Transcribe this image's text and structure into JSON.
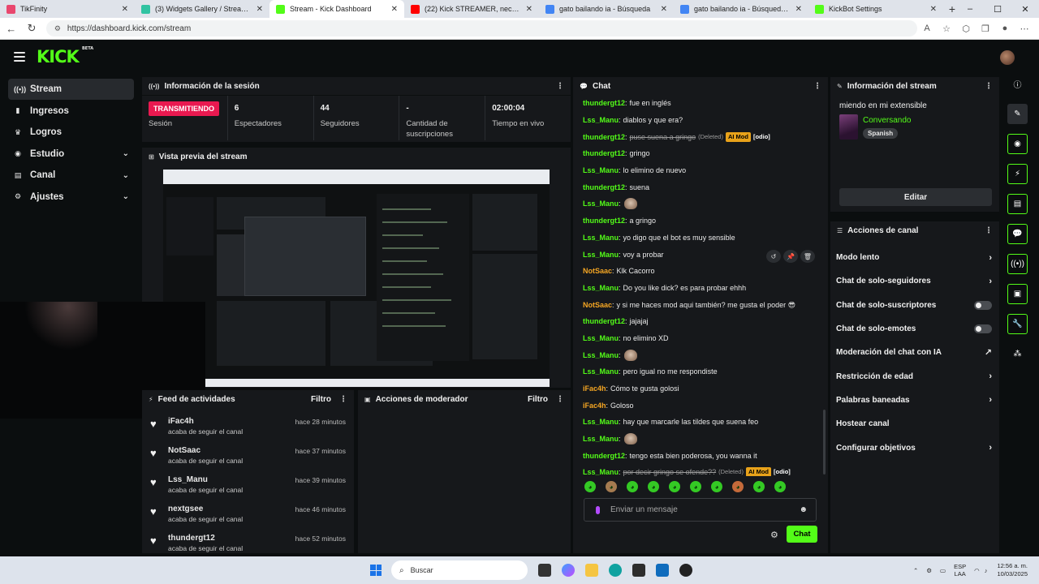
{
  "browser": {
    "tabs": [
      {
        "title": "TikFinity",
        "color": "#e9476e"
      },
      {
        "title": "(3) Widgets Gallery / Streamlabs",
        "color": "#31c3a2"
      },
      {
        "title": "Stream - Kick Dashboard",
        "color": "#53fc18"
      },
      {
        "title": "(22) Kick STREAMER, necesitas Ki",
        "color": "#ff0000"
      },
      {
        "title": "gato bailando ia - Búsqueda",
        "color": "#4285f4"
      },
      {
        "title": "gato bailando ia - Búsqueda Imá",
        "color": "#4285f4"
      },
      {
        "title": "KickBot Settings",
        "color": "#53fc18"
      }
    ],
    "url": "https://dashboard.kick.com/stream"
  },
  "app": {
    "logo": "KICK",
    "logo_badge": "BETA",
    "accent": "#53fc18",
    "sidebar": [
      {
        "label": "Stream",
        "icon": "signal-icon",
        "active": true
      },
      {
        "label": "Ingresos",
        "icon": "chart-icon"
      },
      {
        "label": "Logros",
        "icon": "trophy-icon"
      },
      {
        "label": "Estudio",
        "icon": "studio-icon",
        "chevron": true
      },
      {
        "label": "Canal",
        "icon": "channel-icon",
        "chevron": true
      },
      {
        "label": "Ajustes",
        "icon": "gear-icon",
        "chevron": true
      }
    ]
  },
  "session": {
    "title": "Información de la sesión",
    "status": "TRANSMITIENDO",
    "status_label": "Sesión",
    "stats": [
      {
        "value": "6",
        "label": "Espectadores"
      },
      {
        "value": "44",
        "label": "Seguidores"
      },
      {
        "value": "-",
        "label": "Cantidad de suscripciones"
      },
      {
        "value": "02:00:04",
        "label": "Tiempo en vivo"
      }
    ]
  },
  "preview": {
    "title": "Vista previa del stream"
  },
  "feed": {
    "title": "Feed de actividades",
    "filter": "Filtro",
    "items": [
      {
        "name": "iFac4h",
        "action": "acaba de seguir el canal",
        "time": "hace 28 minutos"
      },
      {
        "name": "NotSaac",
        "action": "acaba de seguir el canal",
        "time": "hace 37 minutos"
      },
      {
        "name": "Lss_Manu",
        "action": "acaba de seguir el canal",
        "time": "hace 39 minutos"
      },
      {
        "name": "nextgsee",
        "action": "acaba de seguir el canal",
        "time": "hace 46 minutos"
      },
      {
        "name": "thundergt12",
        "action": "acaba de seguir el canal",
        "time": "hace 52 minutos"
      }
    ]
  },
  "modactions": {
    "title": "Acciones de moderador",
    "filter": "Filtro"
  },
  "chat": {
    "title": "Chat",
    "placeholder": "Enviar un mensaje",
    "send": "Chat",
    "messages": [
      {
        "user": "thundergt12",
        "color": "#53fc18",
        "text": "fue en inglés"
      },
      {
        "user": "Lss_Manu",
        "color": "#53fc18",
        "text": "diablos y que era?"
      },
      {
        "user": "thundergt12",
        "color": "#53fc18",
        "text": "puse suena a gringo",
        "deleted": true,
        "deleted_label": "(Deleted)",
        "badge": "AI Mod",
        "tag": "[odio]"
      },
      {
        "user": "thundergt12",
        "color": "#53fc18",
        "text": "gringo"
      },
      {
        "user": "Lss_Manu",
        "color": "#53fc18",
        "text": "lo elimino de nuevo"
      },
      {
        "user": "thundergt12",
        "color": "#53fc18",
        "text": "suena"
      },
      {
        "user": "Lss_Manu",
        "color": "#53fc18",
        "text": "",
        "emote": true
      },
      {
        "user": "thundergt12",
        "color": "#53fc18",
        "text": "a gringo"
      },
      {
        "user": "Lss_Manu",
        "color": "#53fc18",
        "text": "yo digo que el bot es muy sensible"
      },
      {
        "user": "Lss_Manu",
        "color": "#53fc18",
        "text": "voy a probar"
      },
      {
        "user": "NotSaac",
        "color": "#f5a623",
        "text": "Klk Cacorro"
      },
      {
        "user": "Lss_Manu",
        "color": "#53fc18",
        "text": "Do you like dick? es para probar ehhh"
      },
      {
        "user": "NotSaac",
        "color": "#f5a623",
        "text": "y si me haces mod aqui también? me gusta el poder 😎"
      },
      {
        "user": "thundergt12",
        "color": "#53fc18",
        "text": "jajajaj"
      },
      {
        "user": "Lss_Manu",
        "color": "#53fc18",
        "text": "no elimino XD"
      },
      {
        "user": "Lss_Manu",
        "color": "#53fc18",
        "text": "",
        "emote": true
      },
      {
        "user": "Lss_Manu",
        "color": "#53fc18",
        "text": "pero igual no me respondiste"
      },
      {
        "user": "iFac4h",
        "color": "#f5a623",
        "text": "Cómo te gusta golosi"
      },
      {
        "user": "iFac4h",
        "color": "#f5a623",
        "text": "Goloso"
      },
      {
        "user": "Lss_Manu",
        "color": "#53fc18",
        "text": "hay que marcarle las tildes que suena feo"
      },
      {
        "user": "Lss_Manu",
        "color": "#53fc18",
        "text": "",
        "emote": true
      },
      {
        "user": "thundergt12",
        "color": "#53fc18",
        "text": "tengo esta bien poderosa, you wanna it"
      },
      {
        "user": "Lss_Manu",
        "color": "#53fc18",
        "text": "por decir gringo se ofende??",
        "deleted": true,
        "deleted_label": "(Deleted)",
        "badge": "AI Mod",
        "tag": "[odio]"
      }
    ]
  },
  "streaminfo": {
    "title": "Información del stream",
    "stream_title": "miendo en mi extensible",
    "category": "Conversando",
    "language": "Spanish",
    "edit": "Editar"
  },
  "channel_actions": {
    "title": "Acciones de canal",
    "items": [
      {
        "label": "Modo lento",
        "kind": "arrow"
      },
      {
        "label": "Chat de solo-seguidores",
        "kind": "arrow"
      },
      {
        "label": "Chat de solo-suscriptores",
        "kind": "toggle",
        "on": false
      },
      {
        "label": "Chat de solo-emotes",
        "kind": "toggle",
        "on": false
      },
      {
        "label": "Moderación del chat con IA",
        "kind": "ext"
      },
      {
        "label": "Restricción de edad",
        "kind": "arrow"
      },
      {
        "label": "Palabras baneadas",
        "kind": "arrow"
      },
      {
        "label": "Hostear canal",
        "kind": "none"
      },
      {
        "label": "Configurar objetivos",
        "kind": "arrow"
      }
    ]
  },
  "taskbar": {
    "search": "Buscar",
    "lang1": "ESP",
    "lang2": "LAA",
    "time": "12:56 a. m.",
    "date": "10/03/2025"
  }
}
